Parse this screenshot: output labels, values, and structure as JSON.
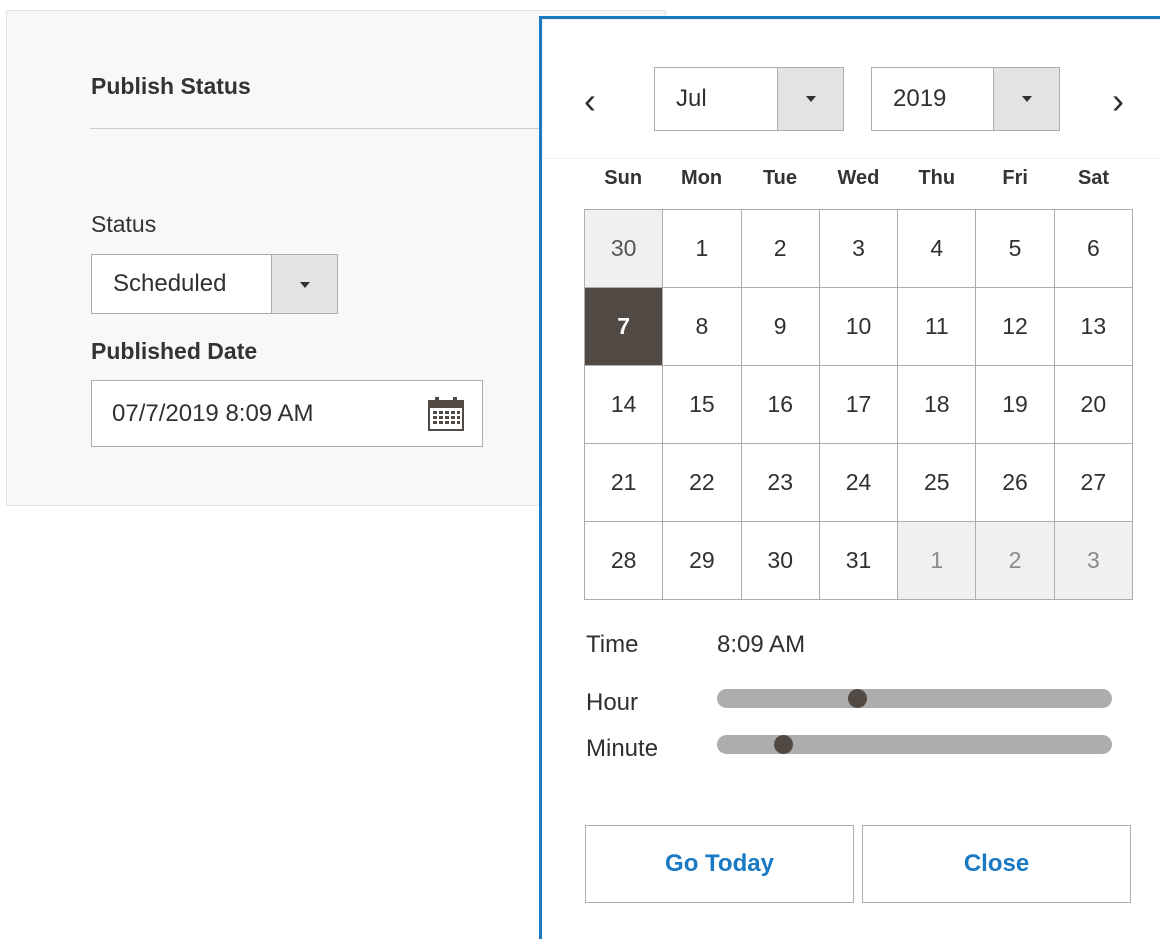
{
  "publish_panel": {
    "title": "Publish Status",
    "status_label": "Status",
    "status_value": "Scheduled",
    "date_label": "Published Date",
    "date_value": "07/7/2019 8:09 AM"
  },
  "datepicker": {
    "prev_symbol": "‹",
    "next_symbol": "›",
    "month": "Jul",
    "year": "2019",
    "weekdays": [
      "Sun",
      "Mon",
      "Tue",
      "Wed",
      "Thu",
      "Fri",
      "Sat"
    ],
    "days": [
      {
        "label": "30",
        "state": "other-prev"
      },
      {
        "label": "1",
        "state": ""
      },
      {
        "label": "2",
        "state": ""
      },
      {
        "label": "3",
        "state": ""
      },
      {
        "label": "4",
        "state": ""
      },
      {
        "label": "5",
        "state": ""
      },
      {
        "label": "6",
        "state": ""
      },
      {
        "label": "7",
        "state": "selected"
      },
      {
        "label": "8",
        "state": ""
      },
      {
        "label": "9",
        "state": ""
      },
      {
        "label": "10",
        "state": ""
      },
      {
        "label": "11",
        "state": ""
      },
      {
        "label": "12",
        "state": ""
      },
      {
        "label": "13",
        "state": ""
      },
      {
        "label": "14",
        "state": ""
      },
      {
        "label": "15",
        "state": ""
      },
      {
        "label": "16",
        "state": ""
      },
      {
        "label": "17",
        "state": ""
      },
      {
        "label": "18",
        "state": ""
      },
      {
        "label": "19",
        "state": ""
      },
      {
        "label": "20",
        "state": ""
      },
      {
        "label": "21",
        "state": ""
      },
      {
        "label": "22",
        "state": ""
      },
      {
        "label": "23",
        "state": ""
      },
      {
        "label": "24",
        "state": ""
      },
      {
        "label": "25",
        "state": ""
      },
      {
        "label": "26",
        "state": ""
      },
      {
        "label": "27",
        "state": ""
      },
      {
        "label": "28",
        "state": ""
      },
      {
        "label": "29",
        "state": ""
      },
      {
        "label": "30",
        "state": ""
      },
      {
        "label": "31",
        "state": ""
      },
      {
        "label": "1",
        "state": "other"
      },
      {
        "label": "2",
        "state": "other"
      },
      {
        "label": "3",
        "state": "other"
      }
    ],
    "time_label": "Time",
    "time_value": "8:09 AM",
    "hour_label": "Hour",
    "minute_label": "Minute",
    "hour_value": 8,
    "hour_max": 23,
    "minute_value": 9,
    "minute_max": 59,
    "go_today_label": "Go Today",
    "close_label": "Close"
  },
  "colors": {
    "accent": "#1979c3",
    "selected_day": "#514943",
    "slider_track": "#adadad"
  },
  "icons": {
    "calendar": "calendar-icon",
    "dropdown": "chevron-down-icon"
  }
}
